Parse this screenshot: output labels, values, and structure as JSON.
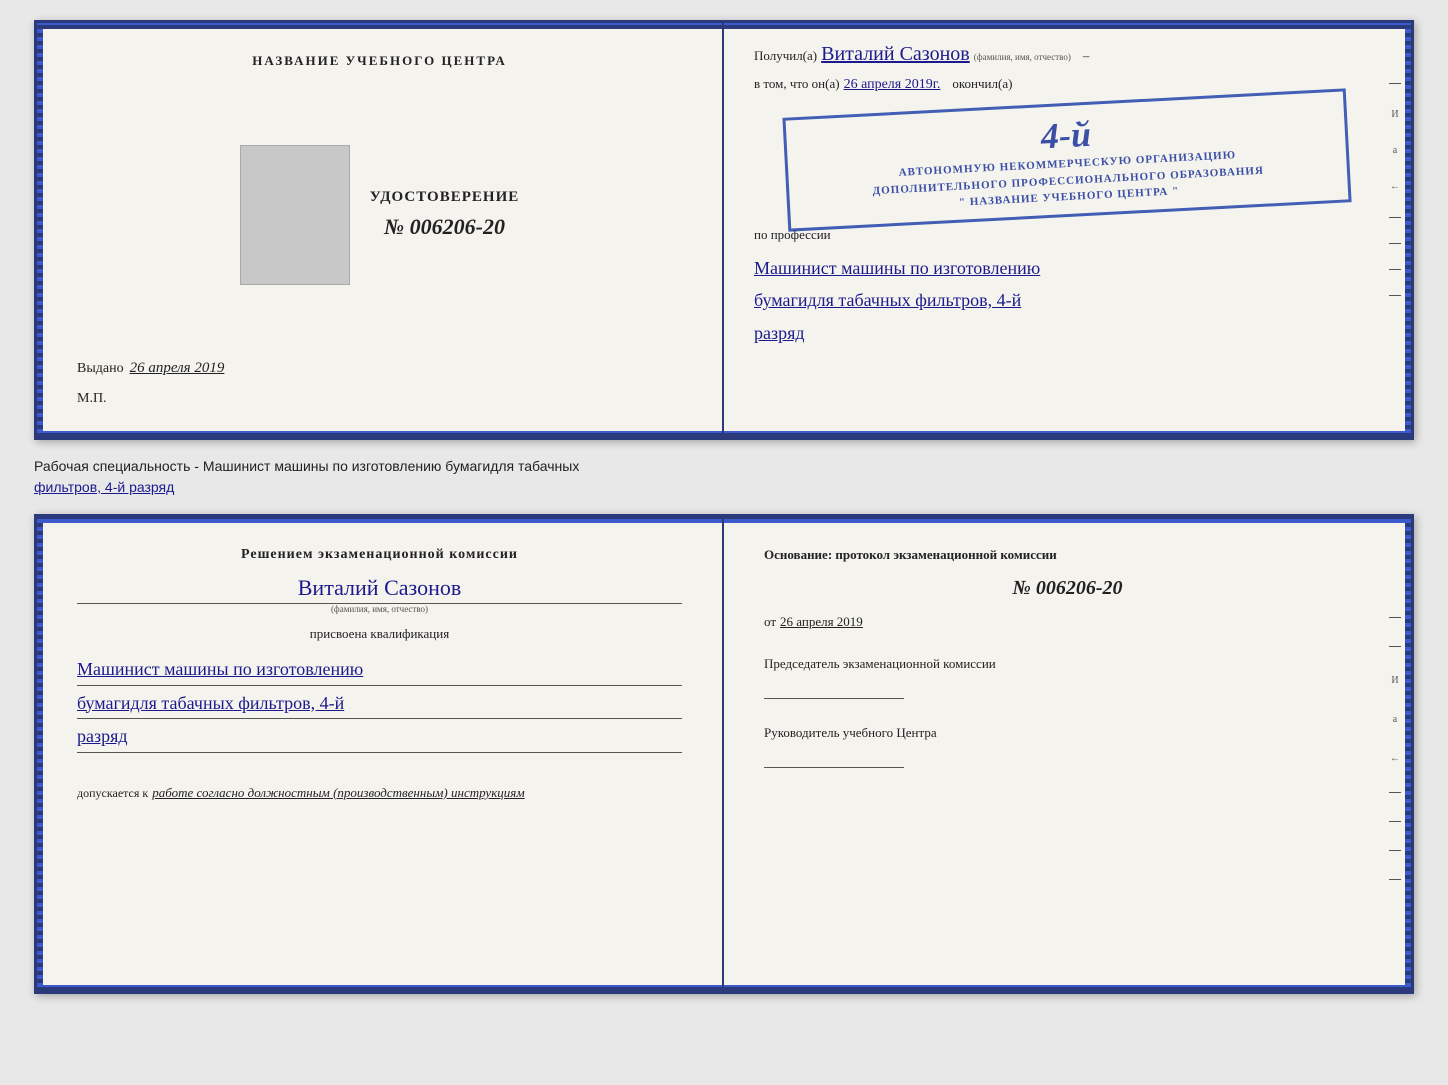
{
  "topDoc": {
    "left": {
      "header": "НАЗВАНИЕ УЧЕБНОГО ЦЕНТРА",
      "udostoverenie_label": "УДОСТОВЕРЕНИЕ",
      "number": "№ 006206-20",
      "vydano_label": "Выдано",
      "vydano_date": "26 апреля 2019",
      "mp_label": "М.П."
    },
    "right": {
      "poluchil_label": "Получил(а)",
      "recipient_name": "Виталий Сазонов",
      "fio_sublabel": "(фамилия, имя, отчество)",
      "dash": "–",
      "vtom_label": "в том, что он(а)",
      "date_value": "26 апреля 2019г.",
      "okonchil_label": "окончил(а)",
      "stamp_number": "4-й",
      "stamp_line1": "АВТОНОМНУЮ НЕКОММЕРЧЕСКУЮ ОРГАНИЗАЦИЮ",
      "stamp_line2": "ДОПОЛНИТЕЛЬНОГО ПРОФЕССИОНАЛЬНОГО ОБРАЗОВАНИЯ",
      "stamp_line3": "\" НАЗВАНИЕ УЧЕБНОГО ЦЕНТРА \"",
      "po_professii_label": "по профессии",
      "profession_line1": "Машинист машины по изготовлению",
      "profession_line2": "бумагидля табачных фильтров, 4-й",
      "profession_line3": "разряд"
    }
  },
  "betweenText": {
    "text": "Рабочая специальность - Машинист машины по изготовлению бумагидля табачных",
    "underline": "фильтров, 4-й разряд"
  },
  "bottomDoc": {
    "left": {
      "resheniyem": "Решением экзаменационной комиссии",
      "name": "Виталий Сазонов",
      "fio_sublabel": "(фамилия, имя, отчество)",
      "prisvoena": "присвоена квалификация",
      "qualification_line1": "Машинист машины по изготовлению",
      "qualification_line2": "бумагидля табачных фильтров, 4-й",
      "qualification_line3": "разряд",
      "dopuskaetsya_label": "допускается к",
      "dopuskaetsya_value": "работе согласно должностным (производственным) инструкциям"
    },
    "right": {
      "osnovanie_label": "Основание: протокол экзаменационной комиссии",
      "protocol_number": "№ 006206-20",
      "ot_label": "от",
      "ot_date": "26 апреля 2019",
      "predsedatel_label": "Председатель экзаменационной комиссии",
      "rukovoditel_label": "Руководитель учебного Центра"
    }
  },
  "decorative": {
    "right_letters": [
      "И",
      "а",
      "←",
      "–",
      "–",
      "–",
      "–"
    ]
  }
}
